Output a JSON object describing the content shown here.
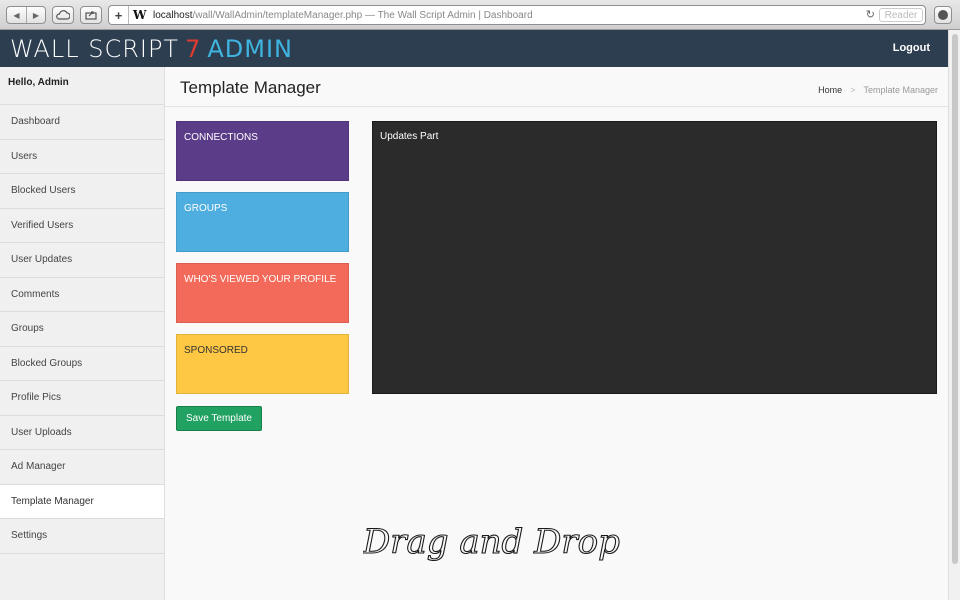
{
  "browser": {
    "url_host": "localhost",
    "url_path": "/wall/WallAdmin/templateManager.php",
    "page_title": " — The Wall Script Admin | Dashboard",
    "favicon": "W",
    "reader_label": "Reader",
    "icons": [
      "back-arrow-icon",
      "forward-arrow-icon",
      "cloud-icon",
      "share-icon",
      "plus-icon",
      "reload-icon",
      "download-icon"
    ]
  },
  "header": {
    "brand_main": "WALL SCRIPT",
    "brand_version": "7",
    "brand_suffix": "ADMIN",
    "logout": "Logout",
    "colors": {
      "bar": "#2c3e50",
      "version": "#e03b2f",
      "suffix": "#3fb4e0"
    }
  },
  "sidebar": {
    "greeting": "Hello, Admin",
    "items": [
      {
        "label": "Dashboard"
      },
      {
        "label": "Users"
      },
      {
        "label": "Blocked Users"
      },
      {
        "label": "Verified Users"
      },
      {
        "label": "User Updates"
      },
      {
        "label": "Comments"
      },
      {
        "label": "Groups"
      },
      {
        "label": "Blocked Groups"
      },
      {
        "label": "Profile Pics"
      },
      {
        "label": "User Uploads"
      },
      {
        "label": "Ad Manager"
      },
      {
        "label": "Template Manager",
        "active": true
      },
      {
        "label": "Settings"
      }
    ]
  },
  "main": {
    "title": "Template Manager",
    "breadcrumb": {
      "home": "Home",
      "sep": ">",
      "current": "Template Manager"
    },
    "blocks": [
      {
        "label": "CONNECTIONS",
        "color": "#5b3c88"
      },
      {
        "label": "GROUPS",
        "color": "#4eaee0"
      },
      {
        "label": "WHO'S VIEWED YOUR PROFILE",
        "color": "#f36a5a"
      },
      {
        "label": "SPONSORED",
        "color": "#fec844"
      }
    ],
    "updates_label": "Updates Part",
    "save_label": "Save Template",
    "annotation": "Drag and Drop"
  }
}
